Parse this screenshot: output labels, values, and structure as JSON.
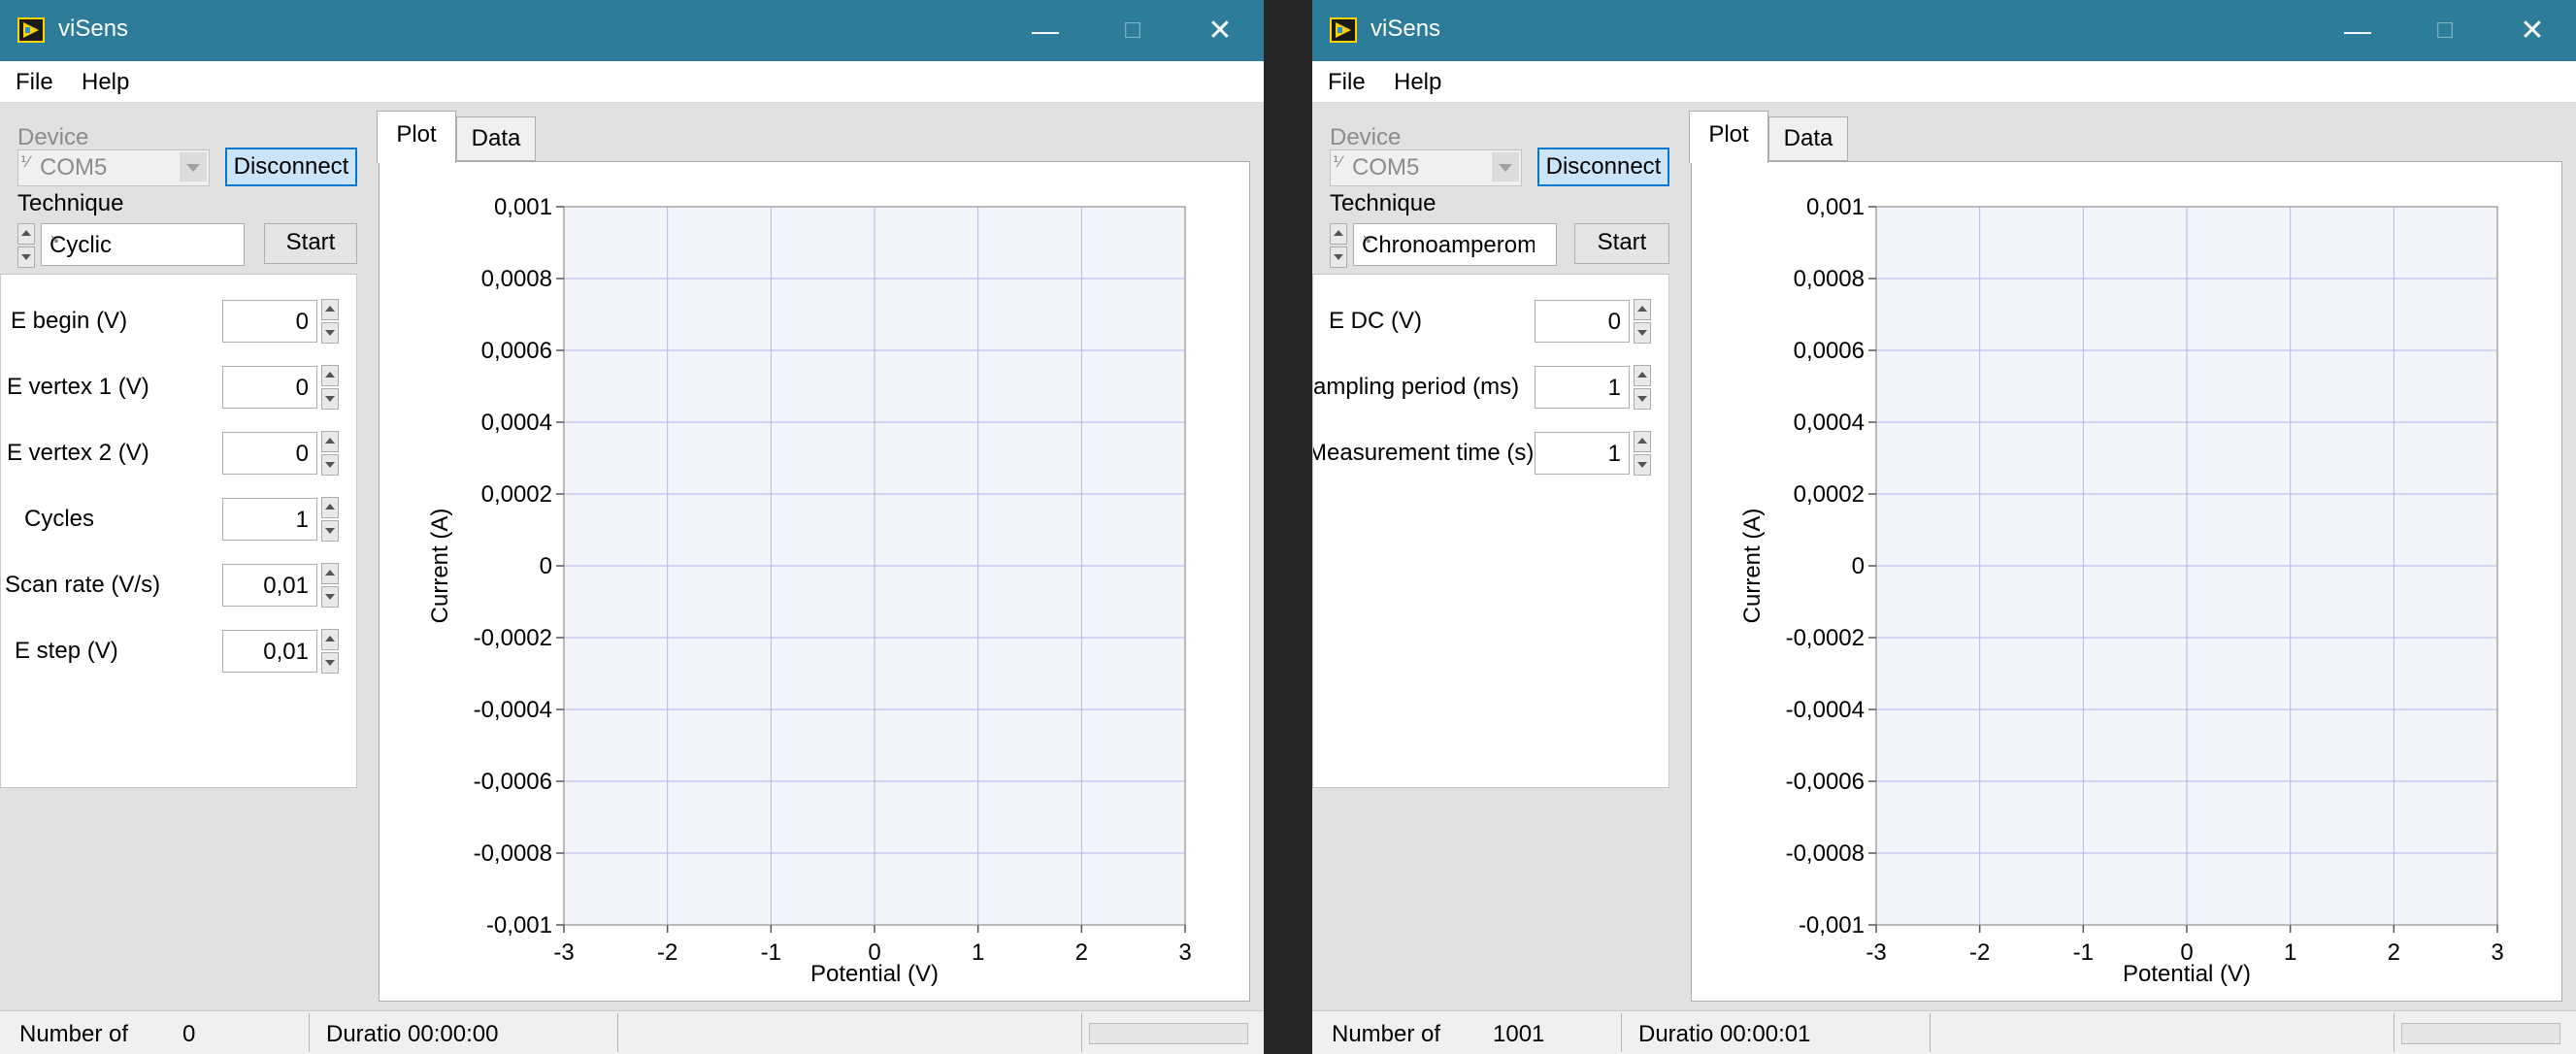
{
  "windows": [
    {
      "title": "viSens",
      "menu": [
        "File",
        "Help"
      ],
      "device_label": "Device",
      "device_prefix": "⅟",
      "device_value": "COM5",
      "disconnect_label": "Disconnect",
      "technique_label": "Technique",
      "technique_value": "Cyclic",
      "start_label": "Start",
      "params": [
        {
          "label": "E begin (V)",
          "value": "0"
        },
        {
          "label": "E vertex 1 (V)",
          "value": "0"
        },
        {
          "label": "E vertex 2 (V)",
          "value": "0"
        },
        {
          "label": "Cycles",
          "value": "1"
        },
        {
          "label": "Scan rate (V/s)",
          "value": "0,01"
        },
        {
          "label": "E step (V)",
          "value": "0,01"
        }
      ],
      "tabs": [
        "Plot",
        "Data"
      ],
      "status": {
        "number_label": "Number of",
        "number_value": "0",
        "duration": "Duratio 00:00:00",
        "progress": 0
      },
      "chart_data": {
        "type": "line",
        "xlabel": "Potential (V)",
        "ylabel": "Current (A)",
        "xlim": [
          -3,
          3
        ],
        "ylim": [
          -0.001,
          0.001
        ],
        "x_ticks": [
          "-3",
          "-2",
          "-1",
          "0",
          "1",
          "2",
          "3"
        ],
        "y_ticks": [
          "0,001",
          "0,0008",
          "0,0006",
          "0,0004",
          "0,0002",
          "0",
          "-0,0002",
          "-0,0004",
          "-0,0006",
          "-0,0008",
          "-0,001"
        ],
        "grid": true,
        "series": []
      }
    },
    {
      "title": "viSens",
      "menu": [
        "File",
        "Help"
      ],
      "device_label": "Device",
      "device_prefix": "⅟",
      "device_value": "COM5",
      "disconnect_label": "Disconnect",
      "technique_label": "Technique",
      "technique_value": "Chronoamperom",
      "start_label": "Start",
      "params": [
        {
          "label": "E DC (V)",
          "value": "0"
        },
        {
          "label": "ampling period (ms)",
          "value": "1"
        },
        {
          "label": "Measurement time (s)",
          "value": "1"
        }
      ],
      "tabs": [
        "Plot",
        "Data"
      ],
      "status": {
        "number_label": "Number of",
        "number_value": "1001",
        "duration": "Duratio 00:00:01",
        "progress": 0
      },
      "chart_data": {
        "type": "line",
        "xlabel": "Potential (V)",
        "ylabel": "Current (A)",
        "xlim": [
          -3,
          3
        ],
        "ylim": [
          -0.001,
          0.001
        ],
        "x_ticks": [
          "-3",
          "-2",
          "-1",
          "0",
          "1",
          "2",
          "3"
        ],
        "y_ticks": [
          "0,001",
          "0,0008",
          "0,0006",
          "0,0004",
          "0,0002",
          "0",
          "-0,0002",
          "-0,0004",
          "-0,0006",
          "-0,0008",
          "-0,001"
        ],
        "grid": true,
        "series": []
      }
    }
  ],
  "colors": {
    "titlebar": "#2d7d9a",
    "grid": "#b4b4e6",
    "axis": "#555555"
  },
  "icons": [
    "app-icon",
    "minimize-icon",
    "maximize-icon",
    "close-icon",
    "dropdown-arrow-icon",
    "spinner-up-icon",
    "spinner-down-icon"
  ]
}
